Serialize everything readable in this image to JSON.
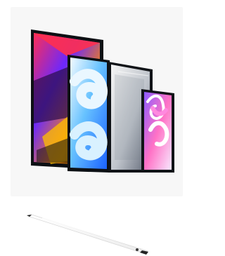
{
  "product_image": {
    "subject": "ipad-lineup",
    "device_count": 4,
    "colors": {
      "bezel": "#101317",
      "background": "#f7f7f7",
      "pro_wallpaper": [
        "#ff2f4f",
        "#5a0cff",
        "#ffb800",
        "#111111"
      ],
      "air_wallpaper": [
        "#74c9ff",
        "#2d6fff",
        "#dff6ff"
      ],
      "ipad_wallpaper": [
        "#f2f2f2",
        "#a0a6b2",
        "#5b6170"
      ],
      "mini_wallpaper": [
        "#a66cff",
        "#ff7bd5",
        "#ffffff"
      ]
    }
  },
  "pencil_image": {
    "subject": "apple-pencil",
    "colors": {
      "body": "#ffffff",
      "tip": "#222222",
      "cap": "#1a1a1a"
    }
  }
}
